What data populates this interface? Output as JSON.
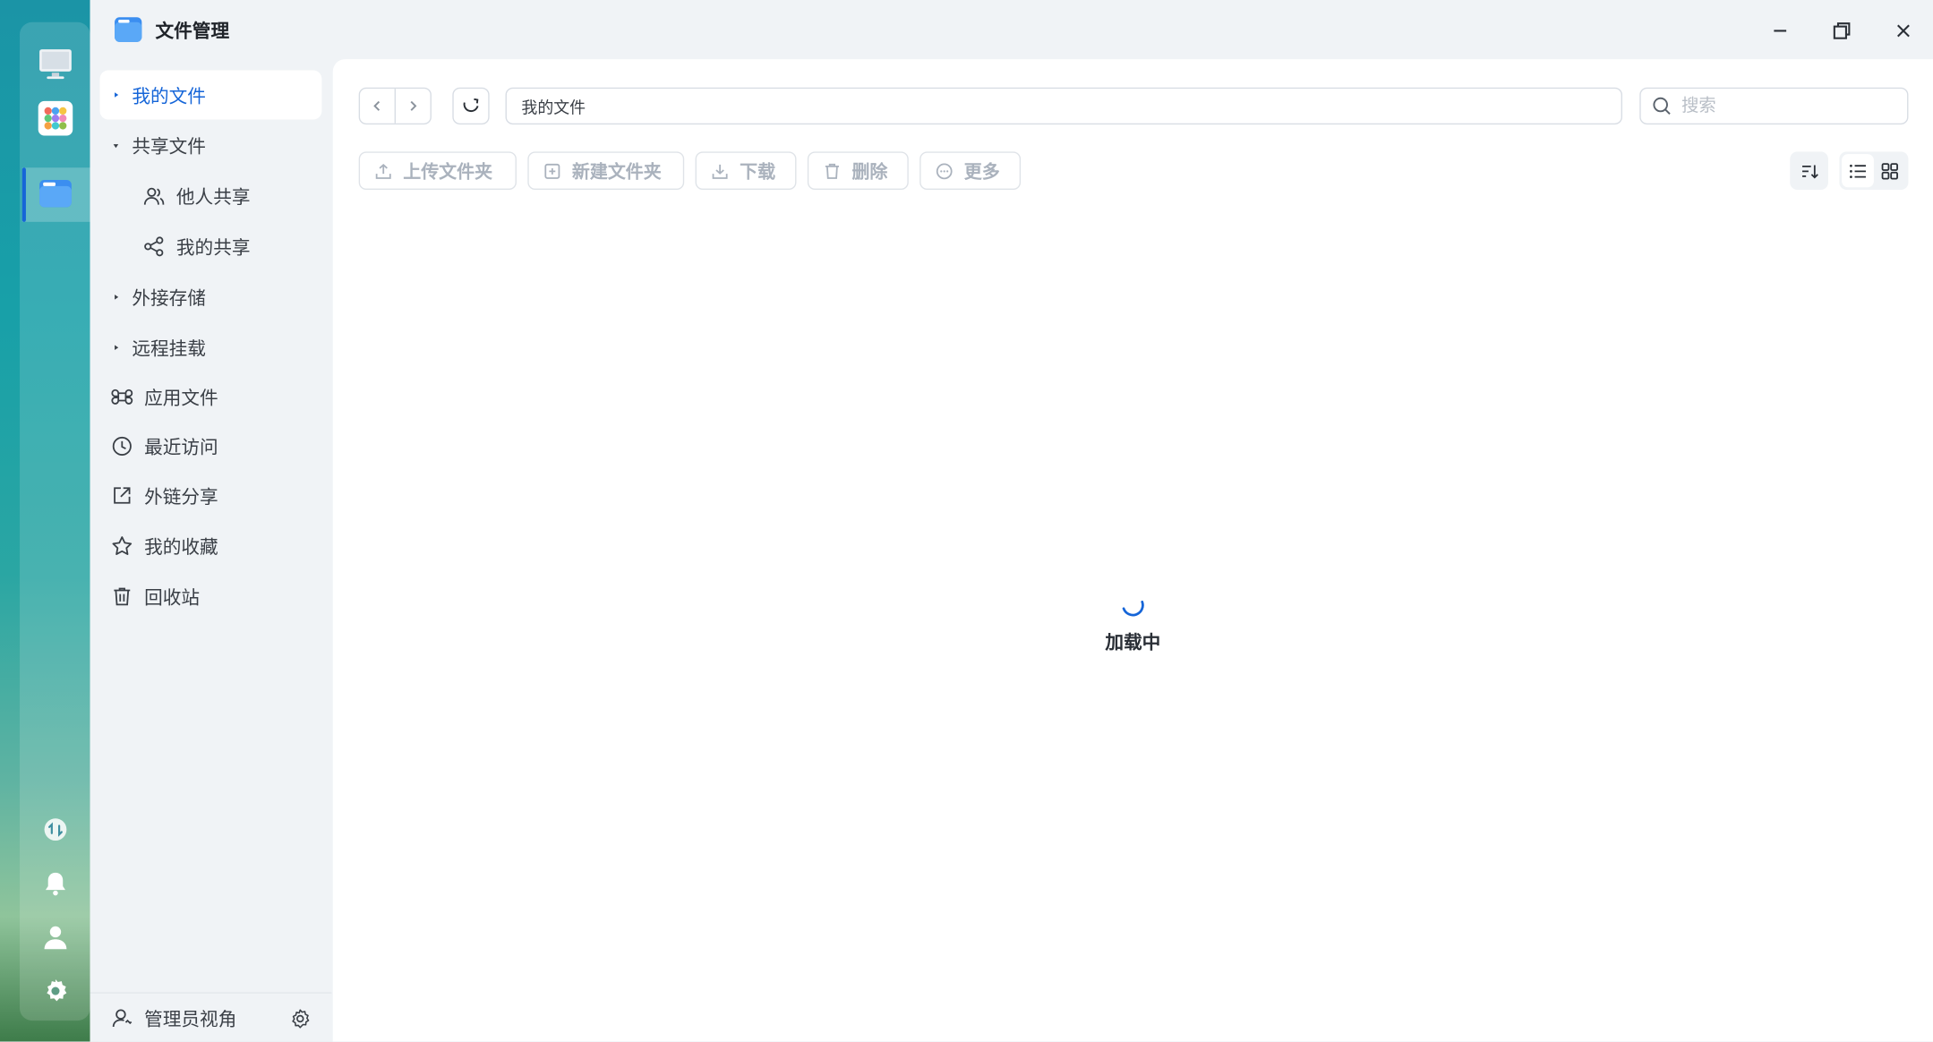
{
  "app": {
    "title": "文件管理"
  },
  "sidebar": {
    "items": [
      {
        "label": "我的文件"
      },
      {
        "label": "共享文件"
      },
      {
        "label": "他人共享"
      },
      {
        "label": "我的共享"
      },
      {
        "label": "外接存储"
      },
      {
        "label": "远程挂载"
      },
      {
        "label": "应用文件"
      },
      {
        "label": "最近访问"
      },
      {
        "label": "外链分享"
      },
      {
        "label": "我的收藏"
      },
      {
        "label": "回收站"
      }
    ],
    "footer": {
      "label": "管理员视角"
    }
  },
  "toolbar": {
    "path": "我的文件",
    "search_placeholder": "搜索",
    "upload": "上传文件夹",
    "new_folder": "新建文件夹",
    "download": "下载",
    "delete": "删除",
    "more": "更多"
  },
  "content": {
    "loading": "加载中"
  },
  "colors": {
    "accent": "#1565d8",
    "dock_gradient_top": "#1b94a6",
    "dock_gradient_bottom": "#3e7c4a"
  }
}
